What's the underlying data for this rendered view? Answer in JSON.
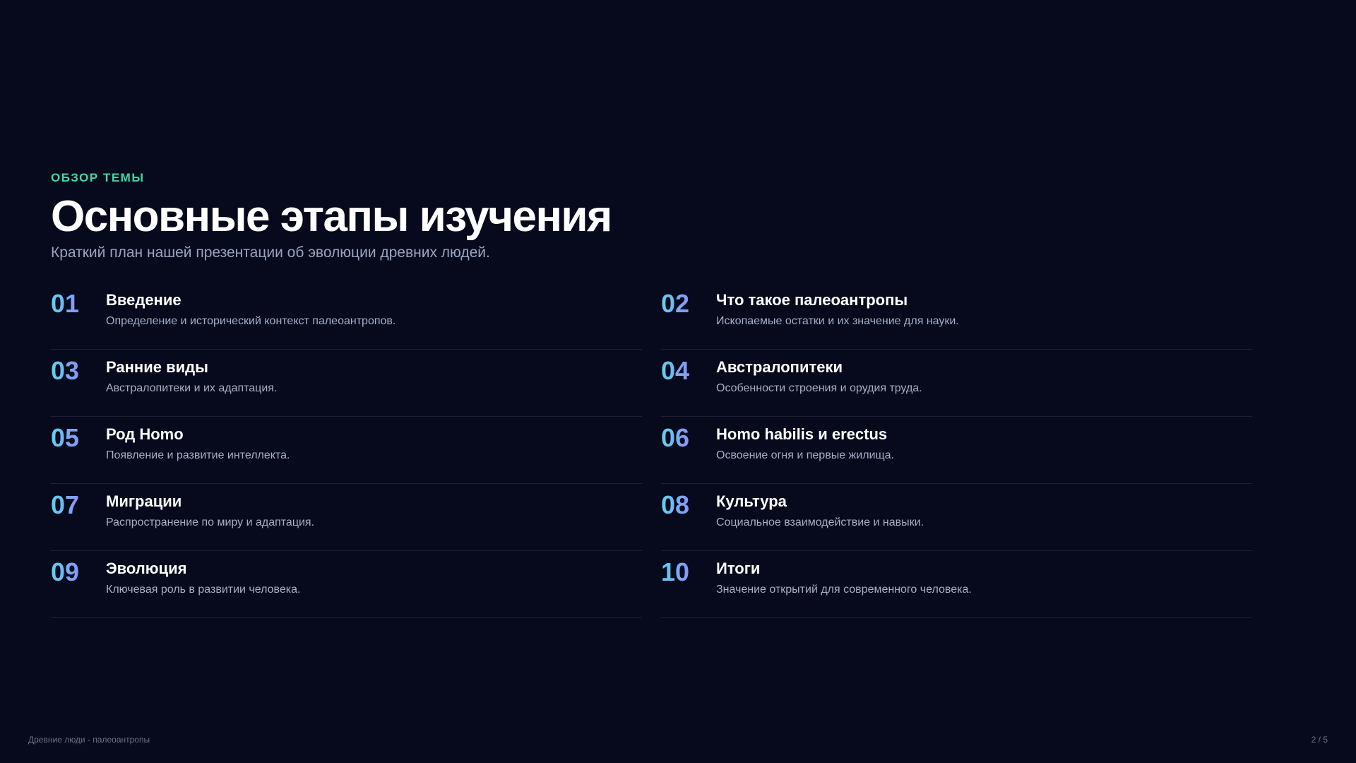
{
  "header": {
    "eyebrow": "ОБЗОР ТЕМЫ",
    "title": "Основные этапы изучения",
    "subtitle": "Краткий план нашей презентации об эволюции древних людей."
  },
  "items": [
    {
      "num": "01",
      "title": "Введение",
      "desc": "Определение и исторический контекст палеоантропов."
    },
    {
      "num": "02",
      "title": "Что такое палеоантропы",
      "desc": "Ископаемые остатки и их значение для науки."
    },
    {
      "num": "03",
      "title": "Ранние виды",
      "desc": "Австралопитеки и их адаптация."
    },
    {
      "num": "04",
      "title": "Австралопитеки",
      "desc": "Особенности строения и орудия труда."
    },
    {
      "num": "05",
      "title": "Род Homo",
      "desc": "Появление и развитие интеллекта."
    },
    {
      "num": "06",
      "title": "Homo habilis и erectus",
      "desc": "Освоение огня и первые жилища."
    },
    {
      "num": "07",
      "title": "Миграции",
      "desc": "Распространение по миру и адаптация."
    },
    {
      "num": "08",
      "title": "Культура",
      "desc": "Социальное взаимодействие и навыки."
    },
    {
      "num": "09",
      "title": "Эволюция",
      "desc": "Ключевая роль в развитии человека."
    },
    {
      "num": "10",
      "title": "Итоги",
      "desc": "Значение открытий для современного человека."
    }
  ],
  "footer": {
    "left": "Древние люди - палеоантропы",
    "page": "2 / 5"
  },
  "colors": {
    "background": "#060a1c",
    "accent": "#3fd9a6",
    "number_gradient_start": "#5ed3ee",
    "number_gradient_end": "#8a92f5"
  }
}
